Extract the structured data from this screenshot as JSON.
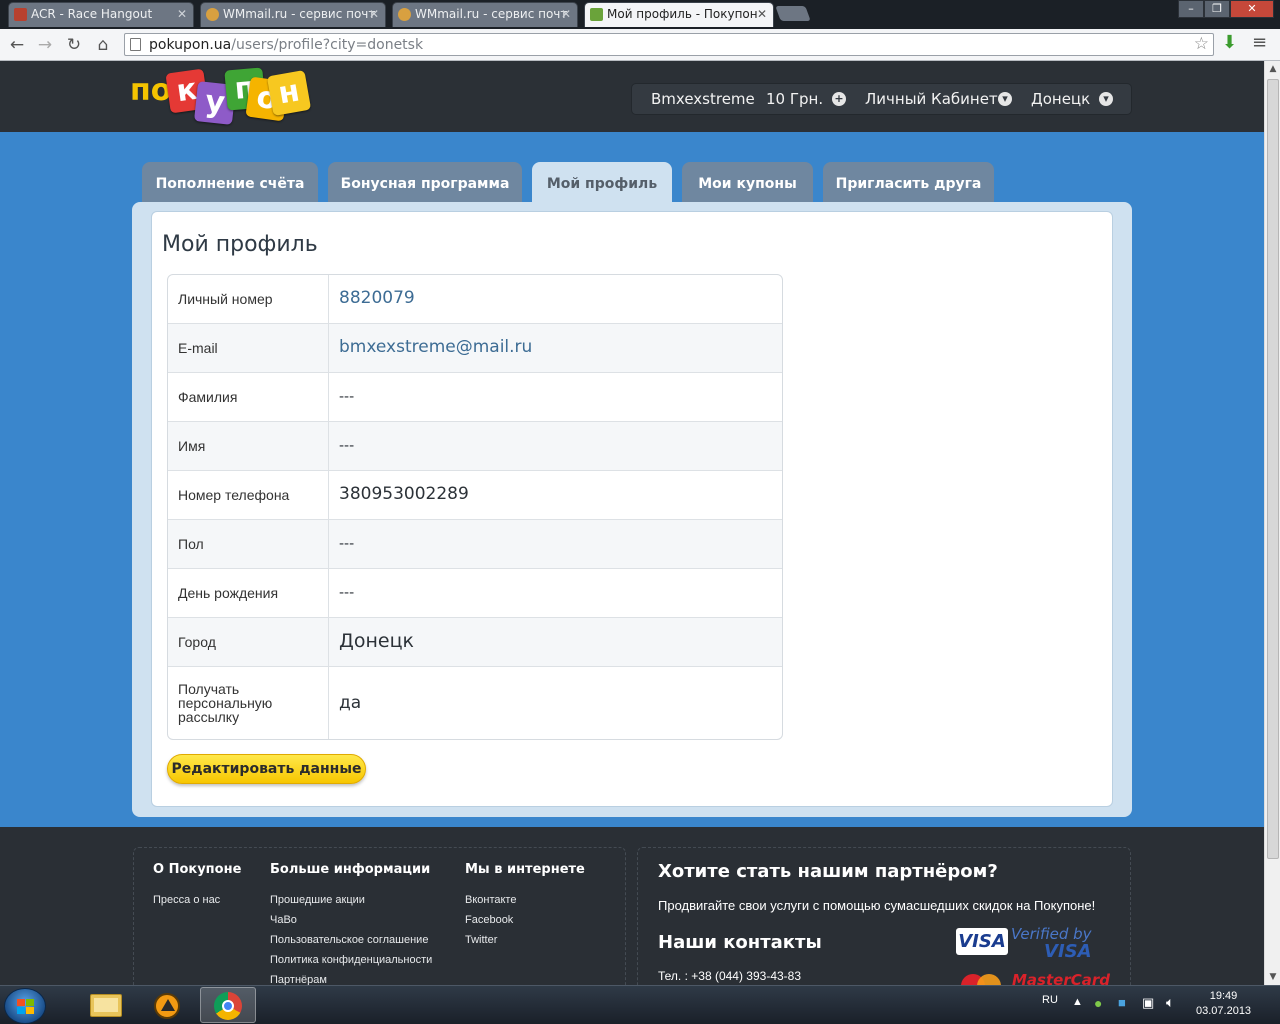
{
  "browser": {
    "tabs": [
      {
        "title": "ACR - Race Hangout",
        "active": false,
        "favicon_color": "#b8412f"
      },
      {
        "title": "WMmail.ru - сервис почт",
        "active": false,
        "favicon_color": "#d8a040"
      },
      {
        "title": "WMmail.ru - сервис почт",
        "active": false,
        "favicon_color": "#d8a040"
      },
      {
        "title": "Мой профиль - Покупон",
        "active": true,
        "favicon_color": "#6aa33a"
      }
    ],
    "url_host": "pokupon.ua",
    "url_path": "/users/profile?city=donetsk"
  },
  "site": {
    "logo_prefix": "по",
    "logo_tags": [
      "к",
      "у",
      "п",
      "о",
      "н"
    ],
    "logo_tag_colors": [
      "#e53935",
      "#8e5bc8",
      "#3fa535",
      "#f5b400",
      "#f7c820"
    ],
    "user_bar": {
      "username": "Bmxexstreme",
      "balance": "10 Грн.",
      "cabinet": "Личный Кабинет",
      "city": "Донецк"
    },
    "tabs": [
      {
        "label": "Пополнение счёта",
        "active": false
      },
      {
        "label": "Бонусная программа",
        "active": false
      },
      {
        "label": "Мой профиль",
        "active": true
      },
      {
        "label": "Мои купоны",
        "active": false
      },
      {
        "label": "Пригласить друга",
        "active": false
      }
    ]
  },
  "profile": {
    "title": "Мой профиль",
    "rows": [
      {
        "label": "Личный номер",
        "value": "8820079",
        "style": "link"
      },
      {
        "label": "E-mail",
        "value": "bmxexstreme@mail.ru",
        "style": "link"
      },
      {
        "label": "Фамилия",
        "value": "---",
        "style": "dash"
      },
      {
        "label": "Имя",
        "value": "---",
        "style": "dash"
      },
      {
        "label": "Номер телефона",
        "value": "380953002289",
        "style": "plain"
      },
      {
        "label": "Пол",
        "value": "---",
        "style": "dash"
      },
      {
        "label": "День рождения",
        "value": "---",
        "style": "dash"
      },
      {
        "label": "Город",
        "value": "Донецк",
        "style": "large"
      },
      {
        "label": "Получать персональную рассылку",
        "value": "да",
        "style": "plain"
      }
    ],
    "edit_button": "Редактировать данные"
  },
  "footer": {
    "col1": {
      "title": "О Покупоне",
      "links": [
        "Пресса о нас"
      ]
    },
    "col2": {
      "title": "Больше информации",
      "links": [
        "Прошедшие акции",
        "ЧаВо",
        "Пользовательское соглашение",
        "Политика конфиденциальности",
        "Партнёрам"
      ]
    },
    "col3": {
      "title": "Мы в интернете",
      "links": [
        "Вконтакте",
        "Facebook",
        "Twitter"
      ]
    },
    "partner_title": "Хотите стать нашим партнёром?",
    "partner_sub": "Продвигайте свои услуги с помощью сумасшедших скидок на Покупоне!",
    "contacts_title": "Наши контакты",
    "phone": "Тел. : +38 (044) 393-43-83",
    "visa": "VISA",
    "verified_line1": "Verified by",
    "verified_line2": "VISA",
    "mastercard": "MasterCard"
  },
  "taskbar": {
    "lang": "RU",
    "time": "19:49",
    "date": "03.07.2013"
  }
}
